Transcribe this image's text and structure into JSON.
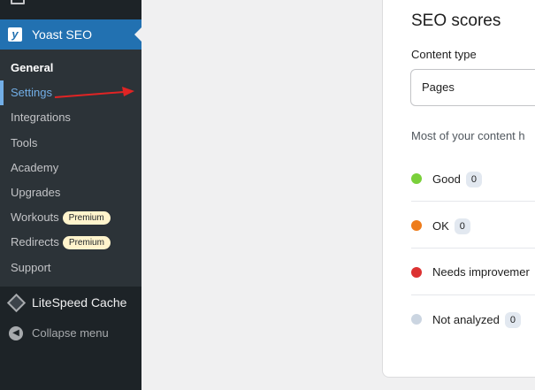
{
  "sidebar": {
    "yoast_label": "Yoast SEO",
    "submenu": [
      {
        "label": "General"
      },
      {
        "label": "Settings"
      },
      {
        "label": "Integrations"
      },
      {
        "label": "Tools"
      },
      {
        "label": "Academy"
      },
      {
        "label": "Upgrades"
      },
      {
        "label": "Workouts",
        "badge": "Premium"
      },
      {
        "label": "Redirects",
        "badge": "Premium"
      },
      {
        "label": "Support"
      }
    ],
    "litespeed_label": "LiteSpeed Cache",
    "collapse_label": "Collapse menu"
  },
  "seo_card": {
    "title": "SEO scores",
    "content_type_label": "Content type",
    "content_type_value": "Pages",
    "description": "Most of your content h",
    "scores": [
      {
        "name": "Good",
        "count": "0",
        "color": "#7ad03a"
      },
      {
        "name": "OK",
        "count": "0",
        "color": "#ee7c1b"
      },
      {
        "name": "Needs improvemer",
        "count": "",
        "color": "#dc3232"
      },
      {
        "name": "Not analyzed",
        "count": "0",
        "color": "#cbd5e1"
      }
    ]
  },
  "colors": {
    "admin_menu_bg": "#1d2327",
    "submenu_bg": "#2c3338",
    "active_blue": "#2271b1",
    "annotation_arrow": "#e02424"
  }
}
